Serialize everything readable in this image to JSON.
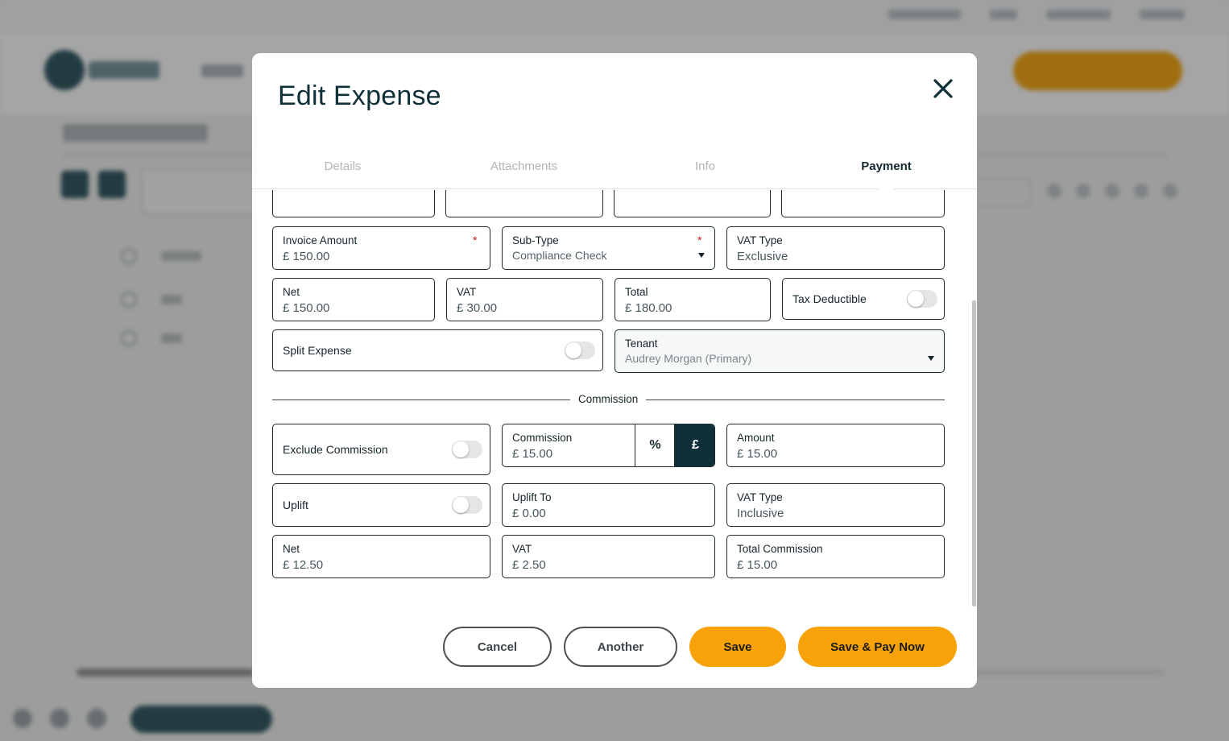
{
  "modal": {
    "title": "Edit Expense",
    "tabs": [
      {
        "label": "Details"
      },
      {
        "label": "Attachments"
      },
      {
        "label": "Info"
      },
      {
        "label": "Payment"
      }
    ],
    "active_tab": "Payment"
  },
  "expense": {
    "invoice_amount": {
      "label": "Invoice Amount",
      "value": "£ 150.00",
      "required": "*"
    },
    "sub_type": {
      "label": "Sub-Type",
      "value": "Compliance Check",
      "required": "*"
    },
    "vat_type": {
      "label": "VAT Type",
      "value": "Exclusive"
    },
    "net": {
      "label": "Net",
      "value": "£ 150.00"
    },
    "vat": {
      "label": "VAT",
      "value": "£ 30.00"
    },
    "total": {
      "label": "Total",
      "value": "£ 180.00"
    },
    "tax_deductible": {
      "label": "Tax Deductible",
      "on": false
    },
    "split_expense": {
      "label": "Split Expense",
      "on": false
    },
    "tenant": {
      "label": "Tenant",
      "value": "Audrey Morgan (Primary)"
    }
  },
  "commission": {
    "section_label": "Commission",
    "exclude": {
      "label": "Exclude Commission",
      "on": false
    },
    "commission": {
      "label": "Commission",
      "value": "£ 15.00",
      "mode_options": [
        "%",
        "£"
      ],
      "active_mode": "£"
    },
    "amount": {
      "label": "Amount",
      "value": "£ 15.00"
    },
    "uplift": {
      "label": "Uplift",
      "on": false
    },
    "uplift_to": {
      "label": "Uplift To",
      "value": "£ 0.00"
    },
    "vat_type": {
      "label": "VAT Type",
      "value": "Inclusive"
    },
    "net": {
      "label": "Net",
      "value": "£ 12.50"
    },
    "vat": {
      "label": "VAT",
      "value": "£ 2.50"
    },
    "total_commission": {
      "label": "Total Commission",
      "value": "£ 15.00"
    }
  },
  "actions": {
    "cancel": "Cancel",
    "another": "Another",
    "save": "Save",
    "save_pay": "Save & Pay Now"
  },
  "colors": {
    "brand_dark": "#0f3038",
    "accent": "#f8a20a",
    "required": "#d0121b"
  }
}
